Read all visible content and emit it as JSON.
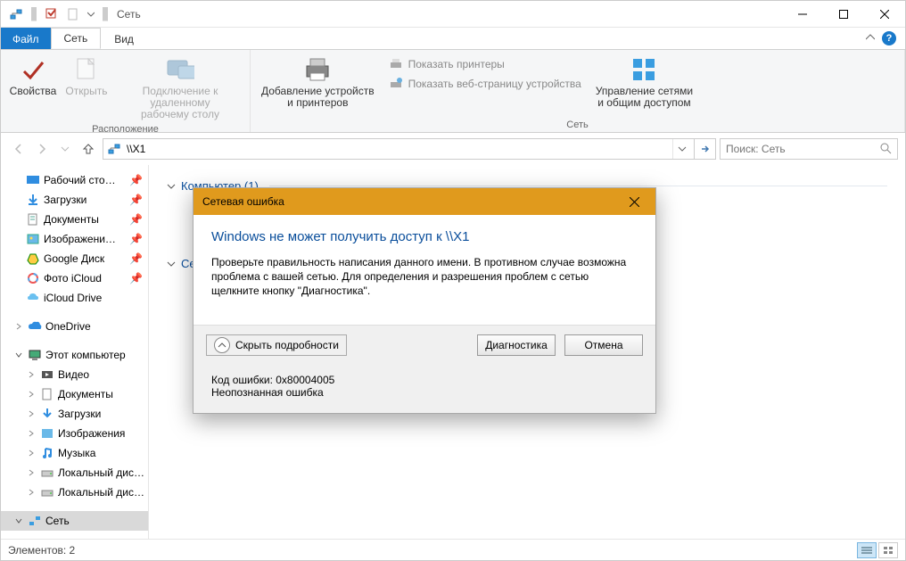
{
  "titlebar": {
    "title": "Сеть"
  },
  "tabs": {
    "file": "Файл",
    "network": "Сеть",
    "view": "Вид"
  },
  "ribbon": {
    "group_location": "Расположение",
    "properties": "Свойства",
    "open": "Открыть",
    "rdp_l1": "Подключение к удаленному",
    "rdp_l2": "рабочему столу",
    "group_network": "Сеть",
    "add_dev_l1": "Добавление устройств",
    "add_dev_l2": "и принтеров",
    "show_printers": "Показать принтеры",
    "show_webpage": "Показать веб-страницу устройства",
    "manage_l1": "Управление сетями",
    "manage_l2": "и общим доступом"
  },
  "nav": {
    "address": "\\\\X1",
    "search_placeholder": "Поиск: Сеть"
  },
  "tree": {
    "desktop": "Рабочий сто…",
    "downloads": "Загрузки",
    "documents": "Документы",
    "pictures": "Изображени…",
    "gdrive": "Google Диск",
    "icloud_photo": "Фото iCloud",
    "icloud_drive": "iCloud Drive",
    "onedrive": "OneDrive",
    "this_pc": "Этот компьютер",
    "videos": "Видео",
    "documents2": "Документы",
    "downloads2": "Загрузки",
    "pictures2": "Изображения",
    "music": "Музыка",
    "localdisk1": "Локальный дис…",
    "localdisk2": "Локальный дис…",
    "network": "Сеть"
  },
  "content": {
    "group_computer": "Компьютер (1)",
    "group_network_devices": "Сетевые"
  },
  "dialog": {
    "title": "Сетевая ошибка",
    "heading": "Windows не может получить доступ к \\\\X1",
    "body": "Проверьте правильность написания данного имени. В противном случае возможна проблема с вашей сетью. Для определения и разрешения проблем с сетью щелкните кнопку \"Диагностика\".",
    "hide_details": "Скрыть подробности",
    "diagnose": "Диагностика",
    "cancel": "Отмена",
    "error_code": "Код ошибки: 0x80004005",
    "error_text": "Неопознанная ошибка"
  },
  "status": {
    "items": "Элементов: 2"
  }
}
